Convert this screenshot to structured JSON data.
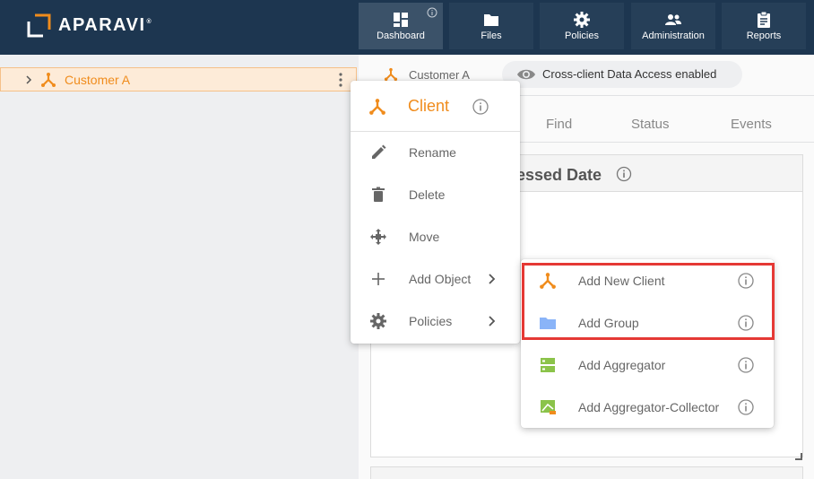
{
  "app": {
    "logo_text": "APARAVI",
    "logo_reg": "®"
  },
  "nav": [
    {
      "label": "Dashboard",
      "icon": "dashboard-icon",
      "active": true
    },
    {
      "label": "Files",
      "icon": "folder-icon"
    },
    {
      "label": "Policies",
      "icon": "gear-icon"
    },
    {
      "label": "Administration",
      "icon": "people-icon"
    },
    {
      "label": "Reports",
      "icon": "clipboard-icon"
    }
  ],
  "tree": {
    "label": "Customer A"
  },
  "header": {
    "breadcrumb": "Customer A",
    "cross_client": "Cross-client Data Access enabled"
  },
  "tabs": [
    "Find",
    "Status",
    "Events"
  ],
  "widget": {
    "title": "essed Date"
  },
  "menu": {
    "title": "Client",
    "items": [
      {
        "label": "Rename",
        "icon": "pencil-icon"
      },
      {
        "label": "Delete",
        "icon": "trash-icon"
      },
      {
        "label": "Move",
        "icon": "move-icon"
      },
      {
        "label": "Add Object",
        "icon": "plus-icon",
        "submenu": true
      },
      {
        "label": "Policies",
        "icon": "gear-icon",
        "submenu": true
      }
    ]
  },
  "submenu": {
    "items": [
      {
        "label": "Add New Client",
        "icon": "client-icon"
      },
      {
        "label": "Add Group",
        "icon": "folder-icon"
      },
      {
        "label": "Add Aggregator",
        "icon": "aggregator-icon"
      },
      {
        "label": "Add Aggregator-Collector",
        "icon": "aggregator-collector-icon"
      }
    ]
  },
  "colors": {
    "topbar": "#1d3650",
    "accent": "#f08c1c",
    "highlight": "#e53935",
    "folder": "#8ab4f8",
    "aggregator": "#8bc34a"
  }
}
